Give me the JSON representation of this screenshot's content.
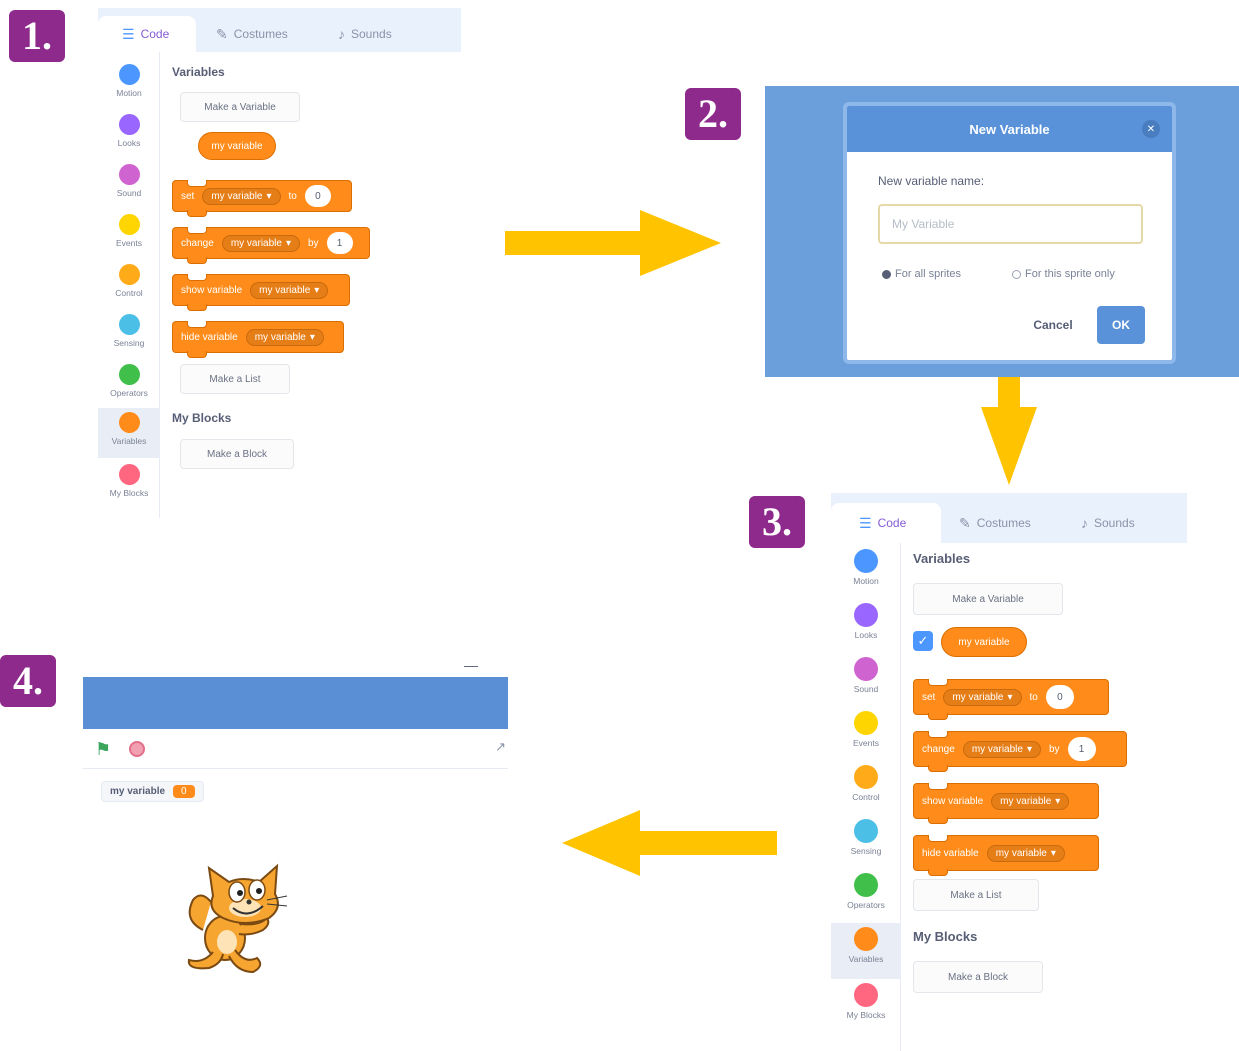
{
  "steps": {
    "one": "1.",
    "two": "2.",
    "three": "3.",
    "four": "4."
  },
  "editor": {
    "tabs": {
      "code": "Code",
      "costumes": "Costumes",
      "sounds": "Sounds"
    },
    "categories": [
      {
        "label": "Motion",
        "color": "#4c97ff"
      },
      {
        "label": "Looks",
        "color": "#9966ff"
      },
      {
        "label": "Sound",
        "color": "#cf63cf"
      },
      {
        "label": "Events",
        "color": "#ffd500"
      },
      {
        "label": "Control",
        "color": "#ffab19"
      },
      {
        "label": "Sensing",
        "color": "#4cbfe6"
      },
      {
        "label": "Operators",
        "color": "#40bf4a"
      },
      {
        "label": "Variables",
        "color": "#ff8c1a"
      },
      {
        "label": "My Blocks",
        "color": "#ff6680"
      }
    ],
    "variables_title": "Variables",
    "make_variable": "Make a Variable",
    "my_variable": "my variable",
    "set_block": {
      "verb": "set",
      "var": "my variable",
      "to": "to",
      "value": "0"
    },
    "change_block": {
      "verb": "change",
      "var": "my variable",
      "by": "by",
      "value": "1"
    },
    "show_block": {
      "verb": "show variable",
      "var": "my variable"
    },
    "hide_block": {
      "verb": "hide variable",
      "var": "my variable"
    },
    "make_list": "Make a List",
    "myblocks_title": "My Blocks",
    "make_block": "Make a Block"
  },
  "dialog": {
    "title": "New Variable",
    "label": "New variable name:",
    "placeholder": "My Variable",
    "radio_all": "For all sprites",
    "radio_this": "For this sprite only",
    "cancel": "Cancel",
    "ok": "OK"
  },
  "stage": {
    "monitor_label": "my variable",
    "monitor_value": "0"
  },
  "colors": {
    "badge": "#8e2a8c",
    "arrow": "#ffc300",
    "variables_orange": "#ff8c1a",
    "dialog_blue": "#5992d8"
  }
}
